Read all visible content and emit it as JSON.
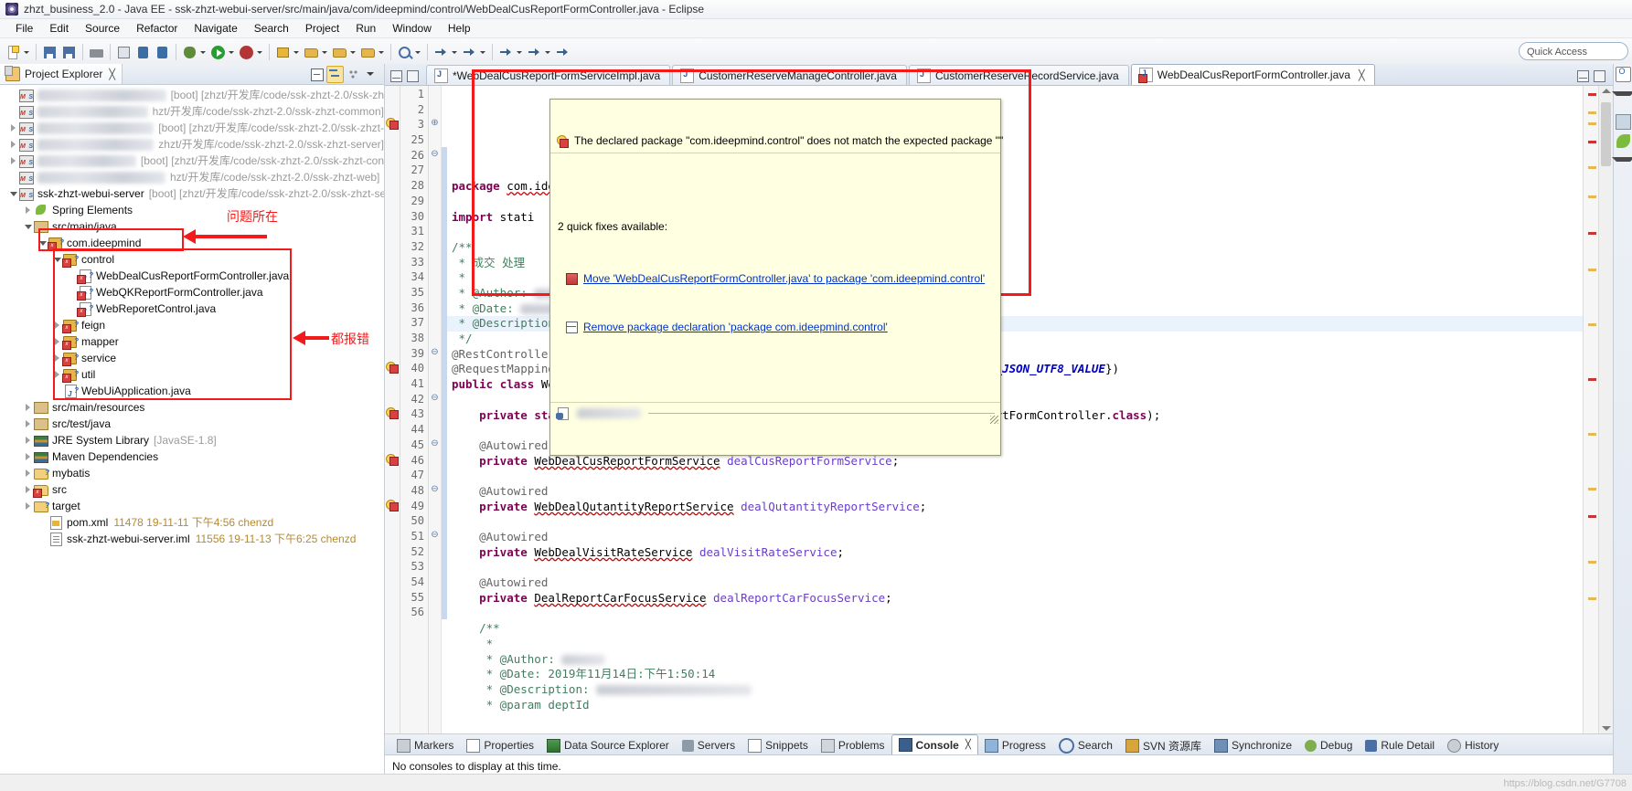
{
  "window": {
    "title": "zhzt_business_2.0 - Java EE - ssk-zhzt-webui-server/src/main/java/com/ideepmind/control/WebDealCusReportFormController.java - Eclipse",
    "icon": "eclipse-icon"
  },
  "menubar": {
    "items": [
      "File",
      "Edit",
      "Source",
      "Refactor",
      "Navigate",
      "Search",
      "Project",
      "Run",
      "Window",
      "Help"
    ]
  },
  "toolbar": {
    "quick_access_placeholder": "Quick Access",
    "buttons": [
      "new-wizard",
      "save",
      "print",
      "debug",
      "run",
      "run-external-tools",
      "new-java-project",
      "new-package",
      "new-class",
      "open-type",
      "search",
      "next-annotation",
      "previous-annotation",
      "back",
      "forward"
    ]
  },
  "project_explorer": {
    "title": "Project Explorer",
    "close_label": "╳",
    "tools": [
      "collapse-all",
      "link-with-editor",
      "view-filters",
      "view-menu"
    ],
    "tree": [
      {
        "indent": 0,
        "twisty": "none",
        "icon": "project",
        "label": "",
        "redacted_width": 160,
        "path": "[boot] [zhzt/开发库/code/ssk-zhzt-2.0/ssk-zh",
        "redacted": true
      },
      {
        "indent": 0,
        "twisty": "none",
        "icon": "project",
        "label": "",
        "redacted_width": 190,
        "path": "hzt/开发库/code/ssk-zhzt-2.0/ssk-zhzt-common]",
        "redacted": true
      },
      {
        "indent": 0,
        "twisty": "collapsed",
        "icon": "project",
        "label": "",
        "redacted_width": 175,
        "path": "[boot] [zhzt/开发库/code/ssk-zhzt-2.0/ssk-zhzt-",
        "redacted": true
      },
      {
        "indent": 0,
        "twisty": "collapsed",
        "icon": "project",
        "label": "",
        "redacted_width": 165,
        "path": "zhzt/开发库/code/ssk-zhzt-2.0/ssk-zhzt-server]",
        "redacted": true
      },
      {
        "indent": 0,
        "twisty": "collapsed",
        "icon": "project",
        "label": "",
        "redacted_width": 150,
        "path": "[boot] [zhzt/开发库/code/ssk-zhzt-2.0/ssk-zhzt-con",
        "redacted": true
      },
      {
        "indent": 0,
        "twisty": "none",
        "icon": "project",
        "label": "",
        "redacted_width": 140,
        "path": "hzt/开发库/code/ssk-zhzt-2.0/ssk-zhzt-web]",
        "redacted": true
      },
      {
        "indent": 0,
        "twisty": "expanded",
        "icon": "project",
        "label": "ssk-zhzt-webui-server",
        "path": "[boot] [zhzt/开发库/code/ssk-zhzt-2.0/ssk-zhzt-ser",
        "redacted": false
      },
      {
        "indent": 1,
        "twisty": "collapsed",
        "icon": "spring-leaf",
        "label": "Spring Elements",
        "path": "",
        "redacted": false
      },
      {
        "indent": 1,
        "twisty": "expanded",
        "icon": "source-folder",
        "label": "src/main/java",
        "path": "",
        "redacted": false
      },
      {
        "indent": 2,
        "twisty": "expanded",
        "icon": "package-error",
        "label": "com.ideepmind",
        "path": "",
        "redacted": false
      },
      {
        "indent": 3,
        "twisty": "expanded",
        "icon": "package-error",
        "label": "control",
        "path": "",
        "redacted": false
      },
      {
        "indent": 4,
        "twisty": "none",
        "icon": "java-file-error",
        "label": "WebDealCusReportFormController.java",
        "path": "",
        "redacted": false
      },
      {
        "indent": 4,
        "twisty": "none",
        "icon": "java-file-error",
        "label": "WebQKReportFormController.java",
        "path": "",
        "redacted": false
      },
      {
        "indent": 4,
        "twisty": "none",
        "icon": "java-file-error",
        "label": "WebReporetControl.java",
        "path": "",
        "redacted": false
      },
      {
        "indent": 3,
        "twisty": "collapsed",
        "icon": "package-error",
        "label": "feign",
        "path": "",
        "redacted": false
      },
      {
        "indent": 3,
        "twisty": "collapsed",
        "icon": "package-error",
        "label": "mapper",
        "path": "",
        "redacted": false
      },
      {
        "indent": 3,
        "twisty": "collapsed",
        "icon": "package-error",
        "label": "service",
        "path": "",
        "redacted": false
      },
      {
        "indent": 3,
        "twisty": "collapsed",
        "icon": "package-error",
        "label": "util",
        "path": "",
        "redacted": false
      },
      {
        "indent": 3,
        "twisty": "none",
        "icon": "java-file",
        "label": "WebUiApplication.java",
        "path": "",
        "redacted": false
      },
      {
        "indent": 1,
        "twisty": "collapsed",
        "icon": "source-folder",
        "label": "src/main/resources",
        "path": "",
        "redacted": false
      },
      {
        "indent": 1,
        "twisty": "collapsed",
        "icon": "source-folder",
        "label": "src/test/java",
        "path": "",
        "redacted": false
      },
      {
        "indent": 1,
        "twisty": "collapsed",
        "icon": "library",
        "label": "JRE System Library",
        "path": "[JavaSE-1.8]",
        "redacted": false
      },
      {
        "indent": 1,
        "twisty": "collapsed",
        "icon": "library",
        "label": "Maven Dependencies",
        "path": "",
        "redacted": false
      },
      {
        "indent": 1,
        "twisty": "collapsed",
        "icon": "folder",
        "label": "mybatis",
        "path": "",
        "redacted": false
      },
      {
        "indent": 1,
        "twisty": "collapsed",
        "icon": "folder-error",
        "label": "src",
        "path": "",
        "redacted": false
      },
      {
        "indent": 1,
        "twisty": "collapsed",
        "icon": "folder",
        "label": "target",
        "path": "",
        "redacted": false
      },
      {
        "indent": 2,
        "twisty": "none",
        "icon": "xml-file",
        "label": "pom.xml",
        "meta": "11478  19-11-11 下午4:56  chenzd",
        "path": "",
        "redacted": false
      },
      {
        "indent": 2,
        "twisty": "none",
        "icon": "doc-file",
        "label": "ssk-zhzt-webui-server.iml",
        "meta": "11556  19-11-13 下午6:25  chenzd",
        "path": "",
        "redacted": false
      }
    ]
  },
  "annotations": [
    {
      "text": "问题所在",
      "note": "points to com.ideepmind package"
    },
    {
      "text": "都报错",
      "note": "points to the package/file group all showing errors"
    }
  ],
  "editor": {
    "tabs": [
      {
        "label": "*WebDealCusReportFormServiceImpl.java",
        "selected": false,
        "dirty": true,
        "error": false
      },
      {
        "label": "CustomerReserveManageController.java",
        "selected": false,
        "dirty": false,
        "error": false
      },
      {
        "label": "CustomerReserveRecordService.java",
        "selected": false,
        "dirty": false,
        "error": false
      },
      {
        "label": "WebDealCusReportFormController.java",
        "selected": true,
        "dirty": false,
        "error": true
      }
    ],
    "lines": [
      {
        "no": "1",
        "fold": "",
        "text": "package com.ideepmind.control;"
      },
      {
        "no": "2",
        "fold": "",
        "text": ""
      },
      {
        "no": "3",
        "fold": "⊕",
        "text": "import stati"
      },
      {
        "no": "25",
        "fold": "",
        "text": ""
      },
      {
        "no": "26",
        "fold": "⊖",
        "text": "/**"
      },
      {
        "no": "27",
        "fold": "",
        "text": " * 成交 处理"
      },
      {
        "no": "28",
        "fold": "",
        "text": " *"
      },
      {
        "no": "29",
        "fold": "",
        "text": " * @Author:"
      },
      {
        "no": "30",
        "fold": "",
        "text": " * @Date:"
      },
      {
        "no": "31",
        "fold": "",
        "text": " * @Description:"
      },
      {
        "no": "32",
        "fold": "",
        "text": " */"
      },
      {
        "no": "33",
        "fold": "",
        "text": "@RestController"
      },
      {
        "no": "34",
        "fold": "",
        "text": "@RequestMapping(value = \"/dealCusReportForm\", produces = {APPLICATION_JSON_UTF8_VALUE})"
      },
      {
        "no": "35",
        "fold": "",
        "text": "public class WebDealCusReportFormController {"
      },
      {
        "no": "36",
        "fold": "",
        "text": ""
      },
      {
        "no": "37",
        "fold": "",
        "text": "    private static final Logger logger = LoggerFactory.getLogger(WebDealCusReportFormController.class);"
      },
      {
        "no": "38",
        "fold": "",
        "text": ""
      },
      {
        "no": "39",
        "fold": "⊖",
        "text": "    @Autowired"
      },
      {
        "no": "40",
        "fold": "",
        "text": "    private WebDealCusReportFormService dealCusReportFormService;"
      },
      {
        "no": "41",
        "fold": "",
        "text": ""
      },
      {
        "no": "42",
        "fold": "⊖",
        "text": "    @Autowired"
      },
      {
        "no": "43",
        "fold": "",
        "text": "    private WebDealQutantityReportService dealQutantityReportService;"
      },
      {
        "no": "44",
        "fold": "",
        "text": ""
      },
      {
        "no": "45",
        "fold": "⊖",
        "text": "    @Autowired"
      },
      {
        "no": "46",
        "fold": "",
        "text": "    private WebDealVisitRateService dealVisitRateService;"
      },
      {
        "no": "47",
        "fold": "",
        "text": ""
      },
      {
        "no": "48",
        "fold": "⊖",
        "text": "    @Autowired"
      },
      {
        "no": "49",
        "fold": "",
        "text": "    private DealReportCarFocusService dealReportCarFocusService;"
      },
      {
        "no": "50",
        "fold": "",
        "text": ""
      },
      {
        "no": "51",
        "fold": "⊖",
        "text": "    /**"
      },
      {
        "no": "52",
        "fold": "",
        "text": "     *"
      },
      {
        "no": "53",
        "fold": "",
        "text": "     * @Author:"
      },
      {
        "no": "54",
        "fold": "",
        "text": "     * @Date: 2019年11月14日:下午1:50:14"
      },
      {
        "no": "55",
        "fold": "",
        "text": "     * @Description:"
      },
      {
        "no": "56",
        "fold": "",
        "text": "     * @param deptId"
      }
    ]
  },
  "error_popup": {
    "message": "The declared package \"com.ideepmind.control\" does not match the expected package \"\"",
    "subtitle": "2 quick fixes available:",
    "fixes": [
      "Move 'WebDealCusReportFormController.java' to package 'com.ideepmind.control'",
      "Remove package declaration 'package com.ideepmind.control'"
    ]
  },
  "bottom_panel": {
    "tabs": [
      {
        "label": "Markers",
        "icon": "markers-icon",
        "selected": false
      },
      {
        "label": "Properties",
        "icon": "properties-icon",
        "selected": false
      },
      {
        "label": "Data Source Explorer",
        "icon": "data-source-icon",
        "selected": false
      },
      {
        "label": "Servers",
        "icon": "servers-icon",
        "selected": false
      },
      {
        "label": "Snippets",
        "icon": "snippets-icon",
        "selected": false
      },
      {
        "label": "Problems",
        "icon": "problems-icon",
        "selected": false
      },
      {
        "label": "Console",
        "icon": "console-icon",
        "selected": true
      },
      {
        "label": "Progress",
        "icon": "progress-icon",
        "selected": false
      },
      {
        "label": "Search",
        "icon": "search-icon",
        "selected": false
      },
      {
        "label": "SVN 资源库",
        "icon": "svn-icon",
        "selected": false
      },
      {
        "label": "Synchronize",
        "icon": "synchronize-icon",
        "selected": false
      },
      {
        "label": "Debug",
        "icon": "debug-icon",
        "selected": false
      },
      {
        "label": "Rule Detail",
        "icon": "rule-detail-icon",
        "selected": false
      },
      {
        "label": "History",
        "icon": "history-icon",
        "selected": false
      }
    ],
    "console_message": "No consoles to display at this time.",
    "console_close_label": "╳"
  },
  "watermark": "https://blog.csdn.net/G7708",
  "colors": {
    "annotation_red": "#f41a1a",
    "tooltip_bg": "#ffffe1",
    "link_blue": "#0033cc",
    "keyword": "#7f0055",
    "string": "#2a00ff",
    "comment": "#3f7f5f"
  }
}
